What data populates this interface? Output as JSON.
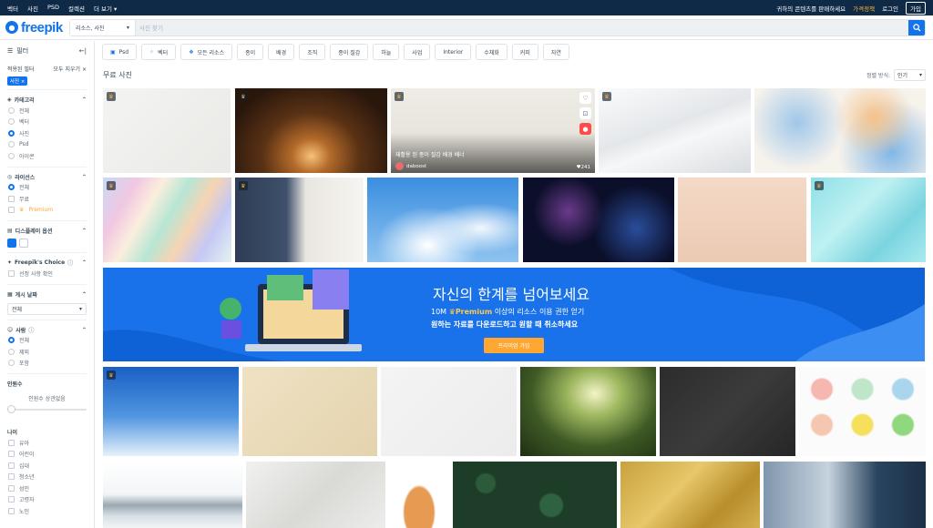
{
  "topbar": {
    "nav": [
      "벡터",
      "사진",
      "PSD",
      "컬렉션",
      "더 보기"
    ],
    "promo": "귀하의 콘텐츠를 판매하세요",
    "pricing": "가격정책",
    "login": "로그인",
    "join": "가입"
  },
  "header": {
    "logo_text": "freepik",
    "category": "리소스, 사진",
    "search_placeholder": "사진 찾기"
  },
  "sidebar": {
    "title": "필터",
    "applied_title": "적용된 필터",
    "clear_all": "모두 지우기",
    "active_chip": "사진",
    "category": {
      "title": "카테고리",
      "options": [
        "전체",
        "벡터",
        "사진",
        "Psd",
        "아이콘"
      ],
      "selected": 2
    },
    "license": {
      "title": "라이선스",
      "options": [
        "전체",
        "무료",
        "Premium"
      ],
      "selected": 0
    },
    "display": {
      "title": "디스플레이 옵션"
    },
    "choice": {
      "title": "Freepik's Choice",
      "option": "선정 사항 확인"
    },
    "date": {
      "title": "게시 날짜",
      "value": "전체"
    },
    "people": {
      "title": "사람",
      "options": [
        "전체",
        "제외",
        "포함"
      ],
      "selected": 0
    },
    "count": {
      "title": "인원수",
      "value": "인원수 상관없음"
    },
    "age": {
      "title": "나이",
      "options": [
        "유아",
        "어린이",
        "십대",
        "청소년",
        "성인",
        "고령자",
        "노인"
      ]
    }
  },
  "chips": [
    "Psd",
    "벡터",
    "모든 리소스",
    "종이",
    "배경",
    "조직",
    "종이 질감",
    "하늘",
    "사업",
    "Interior",
    "수채화",
    "커피",
    "자연"
  ],
  "section_title": "무료 사진",
  "sort": {
    "label": "정렬 방식:",
    "value": "인기"
  },
  "featured": {
    "title": "재활용 된 종이 질감 배경 배너",
    "author": "daboost",
    "likes": "241"
  },
  "banner": {
    "headline": "자신의 한계를 넘어보세요",
    "line1_pre": "10M",
    "line1_premium": "Premium",
    "line1_post": "이상의 리소스 이용 권한 얻기",
    "line2": "원하는 자료를 다운로드하고 원할 때 취소하세요",
    "cta": "프리미엄 가입"
  }
}
